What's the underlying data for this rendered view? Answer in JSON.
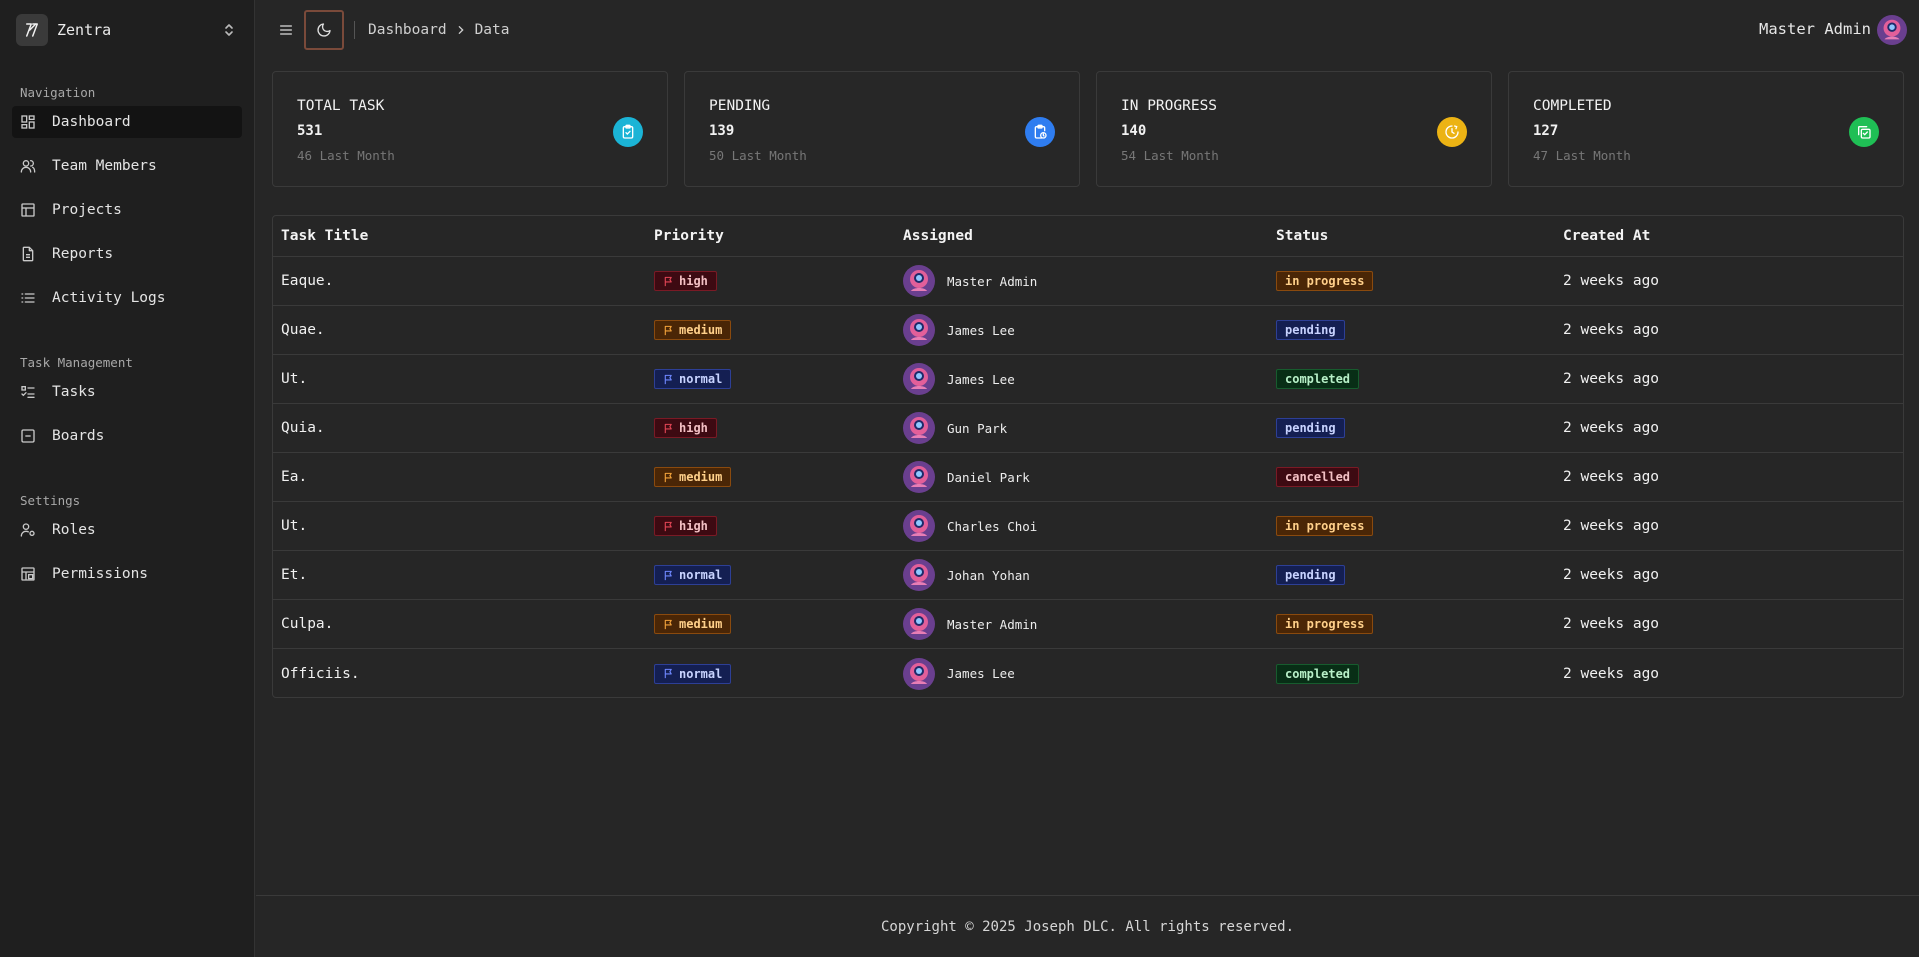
{
  "brand": {
    "name": "Zentra",
    "logo_icon": "scribble-logo-icon",
    "toggle_icon": "chevrons-up-down-icon"
  },
  "sidebar": {
    "groups": [
      {
        "label": "Navigation",
        "items": [
          {
            "label": "Dashboard",
            "icon": "dashboard-icon",
            "active": true
          },
          {
            "label": "Team Members",
            "icon": "users-icon"
          },
          {
            "label": "Projects",
            "icon": "projects-icon"
          },
          {
            "label": "Reports",
            "icon": "report-icon"
          },
          {
            "label": "Activity Logs",
            "icon": "list-icon"
          }
        ]
      },
      {
        "label": "Task Management",
        "items": [
          {
            "label": "Tasks",
            "icon": "tasks-icon"
          },
          {
            "label": "Boards",
            "icon": "board-icon"
          }
        ]
      },
      {
        "label": "Settings",
        "items": [
          {
            "label": "Roles",
            "icon": "user-cog-icon"
          },
          {
            "label": "Permissions",
            "icon": "permissions-icon"
          }
        ]
      }
    ]
  },
  "topbar": {
    "breadcrumb": [
      "Dashboard",
      "Data"
    ],
    "user_name": "Master Admin"
  },
  "stats": [
    {
      "title": "TOTAL TASK",
      "value": "531",
      "sub": "46 Last Month",
      "icon": "clipboard-check-icon",
      "color": "#1bb4d6"
    },
    {
      "title": "PENDING",
      "value": "139",
      "sub": "50 Last Month",
      "icon": "clipboard-clock-icon",
      "color": "#2f7df0"
    },
    {
      "title": "IN PROGRESS",
      "value": "140",
      "sub": "54 Last Month",
      "icon": "clock-progress-icon",
      "color": "#ecb314"
    },
    {
      "title": "COMPLETED",
      "value": "127",
      "sub": "47 Last Month",
      "icon": "copy-check-icon",
      "color": "#1fbf55"
    }
  ],
  "table": {
    "columns": [
      "Task Title",
      "Priority",
      "Assigned",
      "Status",
      "Created At"
    ],
    "rows": [
      {
        "title": "Eaque.",
        "priority": "high",
        "assigned": "Master Admin",
        "status": "in progress",
        "created": "2 weeks ago"
      },
      {
        "title": "Quae.",
        "priority": "medium",
        "assigned": "James Lee",
        "status": "pending",
        "created": "2 weeks ago"
      },
      {
        "title": "Ut.",
        "priority": "normal",
        "assigned": "James Lee",
        "status": "completed",
        "created": "2 weeks ago"
      },
      {
        "title": "Quia.",
        "priority": "high",
        "assigned": "Gun Park",
        "status": "pending",
        "created": "2 weeks ago"
      },
      {
        "title": "Ea.",
        "priority": "medium",
        "assigned": "Daniel Park",
        "status": "cancelled",
        "created": "2 weeks ago"
      },
      {
        "title": "Ut.",
        "priority": "high",
        "assigned": "Charles Choi",
        "status": "in progress",
        "created": "2 weeks ago"
      },
      {
        "title": "Et.",
        "priority": "normal",
        "assigned": "Johan Yohan",
        "status": "pending",
        "created": "2 weeks ago"
      },
      {
        "title": "Culpa.",
        "priority": "medium",
        "assigned": "Master Admin",
        "status": "in progress",
        "created": "2 weeks ago"
      },
      {
        "title": "Officiis.",
        "priority": "normal",
        "assigned": "James Lee",
        "status": "completed",
        "created": "2 weeks ago"
      }
    ]
  },
  "footer": {
    "text": "Copyright © 2025 Joseph DLC. All rights reserved."
  }
}
